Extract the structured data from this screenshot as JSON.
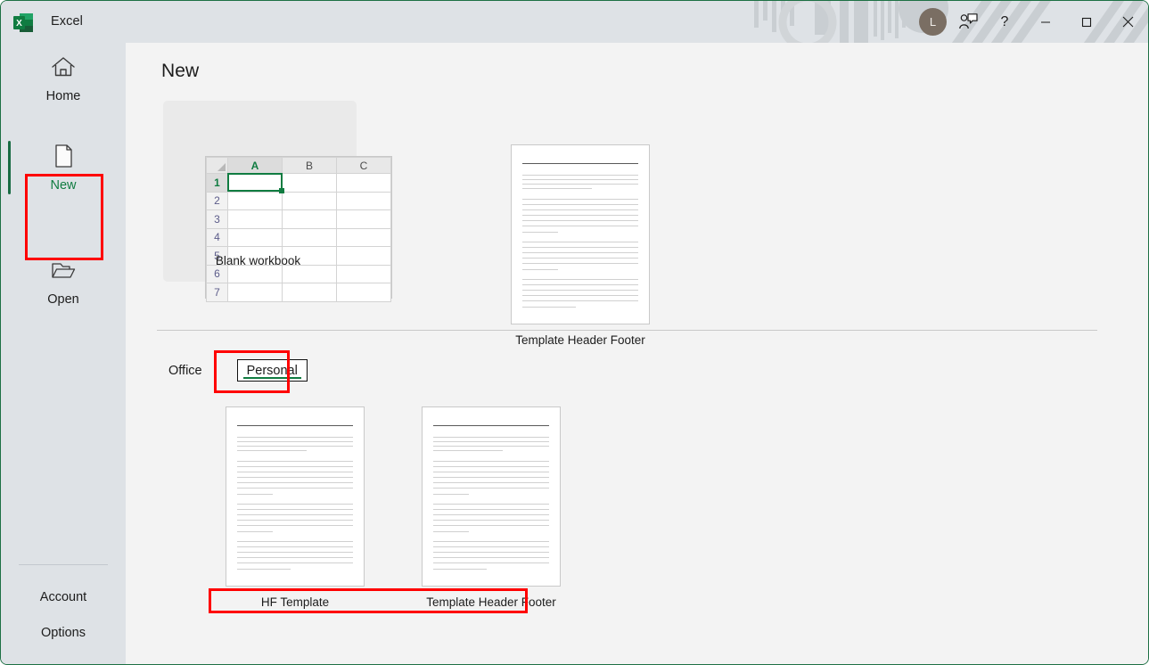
{
  "window": {
    "app_title": "Excel",
    "app_icon": "excel-logo-icon",
    "border_color": "#1d7044",
    "titlebar_bg": "#dee2e6",
    "content_bg": "#f3f3f3"
  },
  "titlebar": {
    "avatar_initial": "L",
    "comments_icon": "person-comment-icon",
    "help_label": "?",
    "minimize_label": "—",
    "maximize_label": "□",
    "close_label": "✕"
  },
  "sidebar": {
    "items": [
      {
        "label": "Home",
        "icon": "home-icon",
        "selected": false
      },
      {
        "label": "New",
        "icon": "new-document-icon",
        "selected": true
      },
      {
        "label": "Open",
        "icon": "open-folder-icon",
        "selected": false
      }
    ],
    "bottom_items": [
      {
        "label": "Account"
      },
      {
        "label": "Options"
      }
    ],
    "accent_color": "#107c41"
  },
  "main": {
    "page_title": "New",
    "featured": [
      {
        "label": "Blank workbook",
        "type": "spreadsheet-thumbnail",
        "selected": true
      },
      {
        "label": "Template Header Footer",
        "type": "document-thumbnail"
      }
    ],
    "blank_workbook": {
      "columns": [
        "A",
        "B",
        "C"
      ],
      "rows": [
        "1",
        "2",
        "3",
        "4",
        "5",
        "6",
        "7"
      ],
      "selected_cell": "A1"
    },
    "tabs": [
      {
        "label": "Office",
        "active": false
      },
      {
        "label": "Personal",
        "active": true
      }
    ],
    "personal_templates": [
      {
        "label": "HF Template",
        "type": "document-thumbnail"
      },
      {
        "label": "Template Header Footer",
        "type": "document-thumbnail"
      }
    ]
  },
  "annotations": {
    "color": "#ff0000",
    "boxes": [
      "sidebar-new-item",
      "personal-tab",
      "personal-template-labels"
    ]
  }
}
